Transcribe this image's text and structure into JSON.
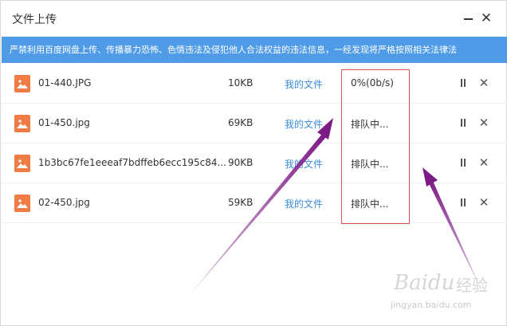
{
  "window": {
    "title": "文件上传",
    "close_icon": "✕"
  },
  "banner": {
    "text": "严禁利用百度网盘上传、传播暴力恐怖、色情违法及侵犯他人合法权益的违法信息，一经发现将严格按照相关法律法"
  },
  "uploads": [
    {
      "name": "01-440.JPG",
      "size": "10KB",
      "link": "我的文件",
      "status": "0%(0b/s)",
      "remove": "✕"
    },
    {
      "name": "01-450.jpg",
      "size": "69KB",
      "link": "我的文件",
      "status": "排队中...",
      "remove": "✕"
    },
    {
      "name": "1b3bc67fe1eeeaf7bdffeb6ecc195c84...",
      "size": "90KB",
      "link": "我的文件",
      "status": "排队中...",
      "remove": "✕"
    },
    {
      "name": "02-450.jpg",
      "size": "59KB",
      "link": "我的文件",
      "status": "排队中...",
      "remove": "✕"
    }
  ],
  "colors": {
    "banner_bg": "#4f9be8",
    "file_icon": "#f07c45",
    "link": "#3b8cdb",
    "annotation_box": "#d9534f",
    "annotation_arrow": "#7d1a86"
  },
  "watermark": {
    "brand": "Baidu",
    "brand_cn": "经验",
    "url": "jingyan.baidu.com"
  }
}
